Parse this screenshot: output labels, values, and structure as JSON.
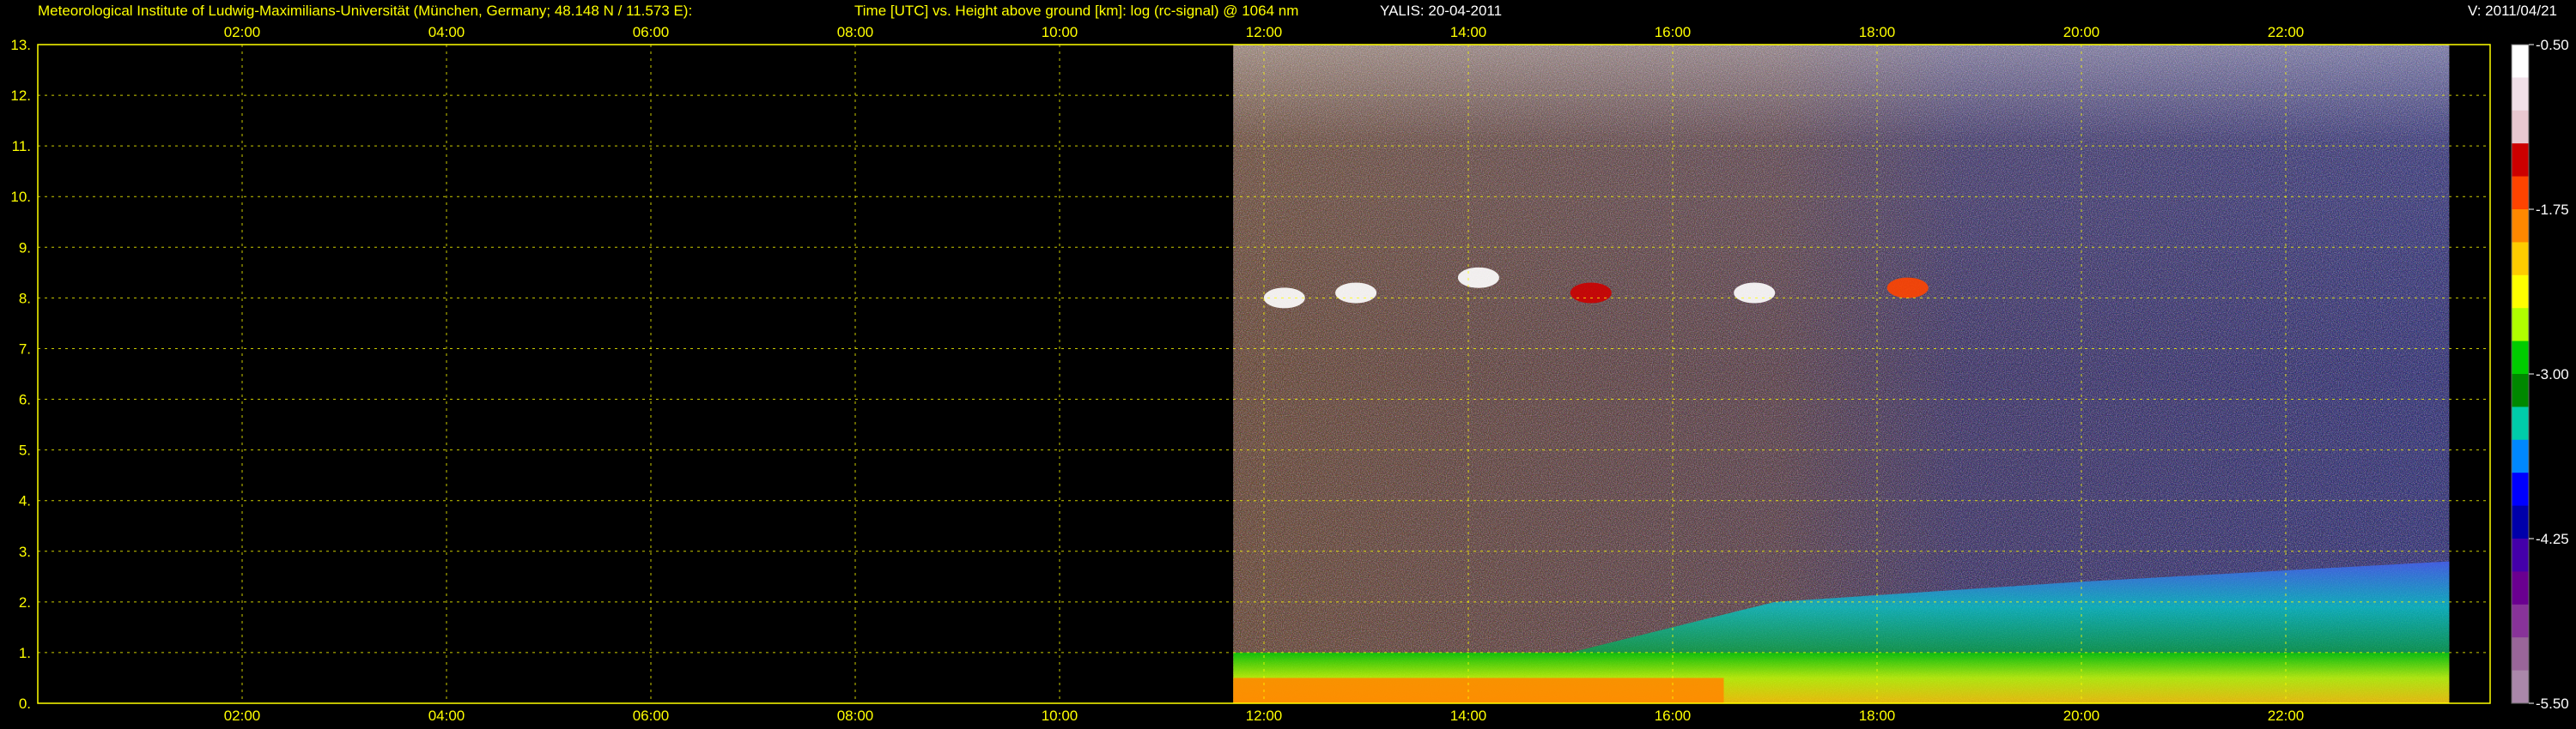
{
  "header": {
    "institute": "Meteorological Institute of Ludwig-Maximilians-Universität (München, Germany; 48.148 N / 11.573 E):",
    "title": "Time [UTC] vs. Height above ground [km]: log (rc-signal) @ 1064 nm",
    "instrument": "YALIS: 20-04-2011",
    "version": "V: 2011/04/21"
  },
  "chart_data": {
    "type": "heatmap",
    "title": "Time [UTC] vs. Height above ground [km]: log (rc-signal) @ 1064 nm",
    "xlabel": "",
    "ylabel": "",
    "xlim": [
      0,
      24
    ],
    "ylim": [
      0,
      13
    ],
    "x_ticks": [
      "02:00",
      "04:00",
      "06:00",
      "08:00",
      "10:00",
      "12:00",
      "14:00",
      "16:00",
      "18:00",
      "20:00",
      "22:00"
    ],
    "x_tick_hours": [
      2,
      4,
      6,
      8,
      10,
      12,
      14,
      16,
      18,
      20,
      22
    ],
    "y_ticks": [
      "0.",
      "1.",
      "2.",
      "3.",
      "4.",
      "5.",
      "6.",
      "7.",
      "8.",
      "9.",
      "10.",
      "11.",
      "12.",
      "13."
    ],
    "grid": true,
    "data_start_hour": 11.7,
    "data_end_hour": 23.6,
    "colorbar": {
      "range": [
        -5.5,
        -0.5
      ],
      "ticks": [
        "-0.50",
        "-1.75",
        "-3.00",
        "-4.25",
        "-5.50"
      ],
      "tick_values": [
        -0.5,
        -1.75,
        -3.0,
        -4.25,
        -5.5
      ],
      "colors": [
        "#ffffff",
        "#f0e0e8",
        "#e8c8d0",
        "#cc0000",
        "#ff4400",
        "#ff8800",
        "#ffcc00",
        "#ffff00",
        "#b0ff00",
        "#00cc00",
        "#008800",
        "#00ccaa",
        "#0088ff",
        "#0000ff",
        "#0000aa",
        "#4400aa",
        "#6a0090",
        "#883399",
        "#996699",
        "#aa88aa"
      ]
    },
    "features": [
      {
        "name": "boundary layer aerosol (high signal)",
        "start_hour": 11.7,
        "end_hour": 23.6,
        "top_km": 1.0,
        "level": -1.8
      },
      {
        "name": "residual aerosol layer",
        "start_hour": 15.0,
        "end_hour": 23.6,
        "top_km": 2.8,
        "level": -2.2
      },
      {
        "name": "cirrus cloud",
        "hour": 12.2,
        "height_km": 8.0,
        "level": -0.5
      },
      {
        "name": "cirrus cloud",
        "hour": 12.9,
        "height_km": 8.1,
        "level": -0.5
      },
      {
        "name": "cirrus cloud",
        "hour": 14.1,
        "height_km": 8.4,
        "level": -0.5
      },
      {
        "name": "cirrus cloud",
        "hour": 15.2,
        "height_km": 8.1,
        "level": -1.2
      },
      {
        "name": "cirrus cloud",
        "hour": 16.8,
        "height_km": 8.1,
        "level": -0.5
      },
      {
        "name": "cirrus cloud",
        "hour": 18.3,
        "height_km": 8.2,
        "level": -1.6
      }
    ]
  }
}
